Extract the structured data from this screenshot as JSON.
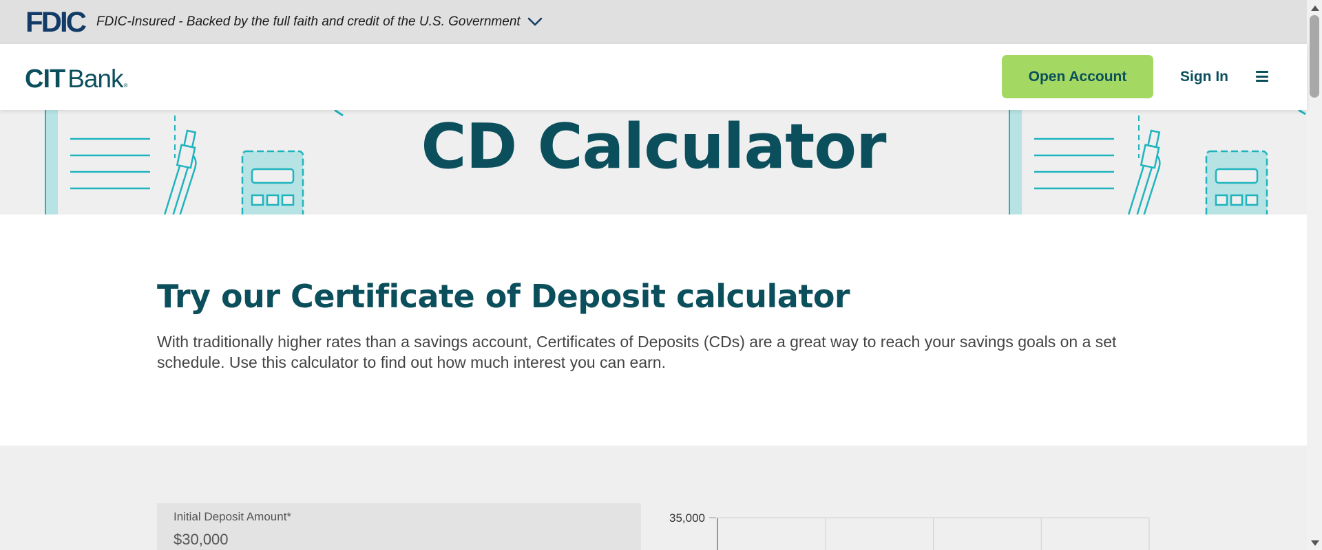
{
  "fdic": {
    "logo": "FDIC",
    "text": "FDIC-Insured - Backed by the full faith and credit of the U.S. Government"
  },
  "header": {
    "logo_cit": "CIT",
    "logo_bank": "Bank",
    "logo_reg": "®",
    "open_account": "Open Account",
    "sign_in": "Sign In"
  },
  "hero": {
    "title": "CD Calculator"
  },
  "intro": {
    "heading": "Try our Certificate of Deposit calculator",
    "text": "With traditionally higher rates than a savings account, Certificates of Deposits (CDs) are a great way to reach your savings goals on a set schedule. Use this calculator to find out how much interest you can earn."
  },
  "calculator": {
    "deposit_label": "Initial Deposit Amount*",
    "deposit_value": "$30,000"
  },
  "chart_data": {
    "type": "bar",
    "title": "",
    "xlabel": "",
    "ylabel": "",
    "y_tick_labels": [
      "35,000"
    ],
    "visible_gridline_columns": 4,
    "categories": [],
    "values": []
  },
  "colors": {
    "brand_teal": "#0b4f5c",
    "accent_green": "#a3d962",
    "illustration_teal": "#1fb4bd",
    "fdic_navy": "#123b67"
  }
}
